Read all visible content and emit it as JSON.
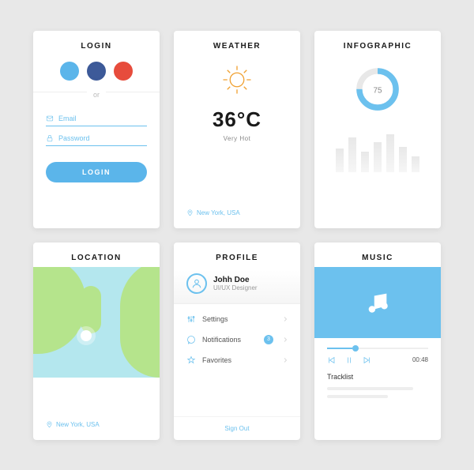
{
  "login": {
    "title": "LOGIN",
    "separator": "or",
    "email_label": "Email",
    "password_label": "Password",
    "button": "LOGIN"
  },
  "weather": {
    "title": "WEATHER",
    "temperature": "36°C",
    "description": "Very Hot",
    "location": "New York, USA"
  },
  "infographic": {
    "title": "INFOGRAPHIC",
    "value": "75"
  },
  "location": {
    "title": "LOCATION",
    "place": "New York, USA"
  },
  "profile": {
    "title": "PROFILE",
    "name": "Johh Doe",
    "role": "UI/UX Designer",
    "settings": "Settings",
    "notifications": "Notifications",
    "notifications_count": "3",
    "favorites": "Favorites",
    "signout": "Sign Out"
  },
  "music": {
    "title": "MUSIC",
    "time": "00:48",
    "tracklist": "Tracklist"
  }
}
